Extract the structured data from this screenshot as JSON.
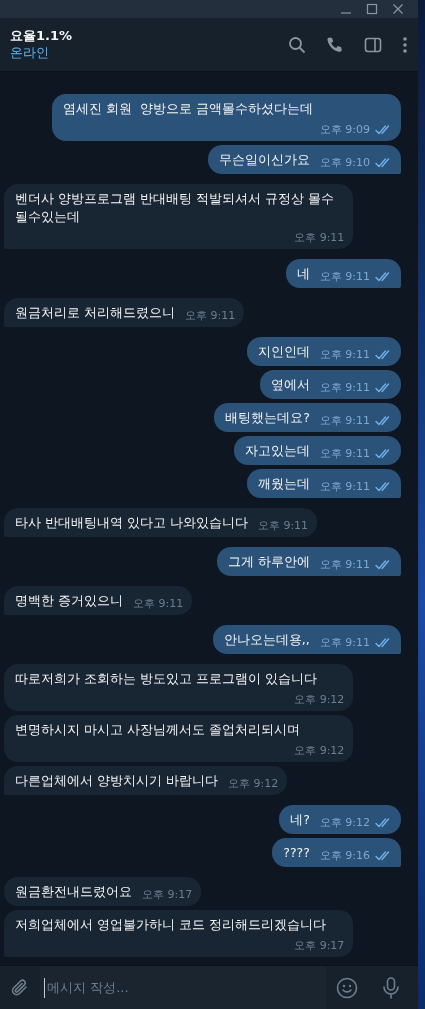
{
  "chat": {
    "title": "요율1.1%",
    "status": "온라인"
  },
  "messages": [
    {
      "kind": "out",
      "text": "염세진 회원  양방으로 금액몰수하셨다는데",
      "time": "오후 9:09"
    },
    {
      "kind": "out",
      "text": "무슨일이신가요",
      "time": "오후 9:10"
    },
    {
      "kind": "in",
      "text": "벤더사 양방프로그램 반대배팅 적발되셔서 규정상 몰수될수있는데",
      "time": "오후 9:11"
    },
    {
      "kind": "out",
      "text": "네",
      "time": "오후 9:11"
    },
    {
      "kind": "in",
      "text": "원금처리로 처리해드렸으니",
      "time": "오후 9:11"
    },
    {
      "kind": "out",
      "text": "지인인데",
      "time": "오후 9:11"
    },
    {
      "kind": "out",
      "text": "옆에서",
      "time": "오후 9:11"
    },
    {
      "kind": "out",
      "text": "배팅했는데요?",
      "time": "오후 9:11"
    },
    {
      "kind": "out",
      "text": "자고있는데",
      "time": "오후 9:11"
    },
    {
      "kind": "out",
      "text": "깨웠는데",
      "time": "오후 9:11"
    },
    {
      "kind": "in",
      "text": "타사 반대배팅내역 있다고 나와있습니다",
      "time": "오후 9:11"
    },
    {
      "kind": "out",
      "text": "그게 하루안에",
      "time": "오후 9:11"
    },
    {
      "kind": "in",
      "text": "명백한 증거있으니",
      "time": "오후 9:11"
    },
    {
      "kind": "out",
      "text": "안나오는데용,,",
      "time": "오후 9:11"
    },
    {
      "kind": "in",
      "text": "따로저희가 조회하는 방도있고 프로그램이 있습니다",
      "time": "오후 9:12"
    },
    {
      "kind": "in",
      "text": "변명하시지 마시고 사장님께서도 졸업처리되시며",
      "time": "오후 9:12"
    },
    {
      "kind": "in",
      "text": "다른업체에서 양방치시기 바랍니다",
      "time": "오후 9:12"
    },
    {
      "kind": "out",
      "text": "네?",
      "time": "오후 9:12"
    },
    {
      "kind": "out",
      "text": "????",
      "time": "오후 9:16"
    },
    {
      "kind": "in",
      "text": "원금환전내드렸어요",
      "time": "오후 9:17"
    },
    {
      "kind": "in",
      "text": "저희업체에서 영업불가하니 코드 정리해드리겠습니다",
      "time": "오후 9:17"
    }
  ],
  "composer": {
    "placeholder": "메시지 작성..."
  }
}
